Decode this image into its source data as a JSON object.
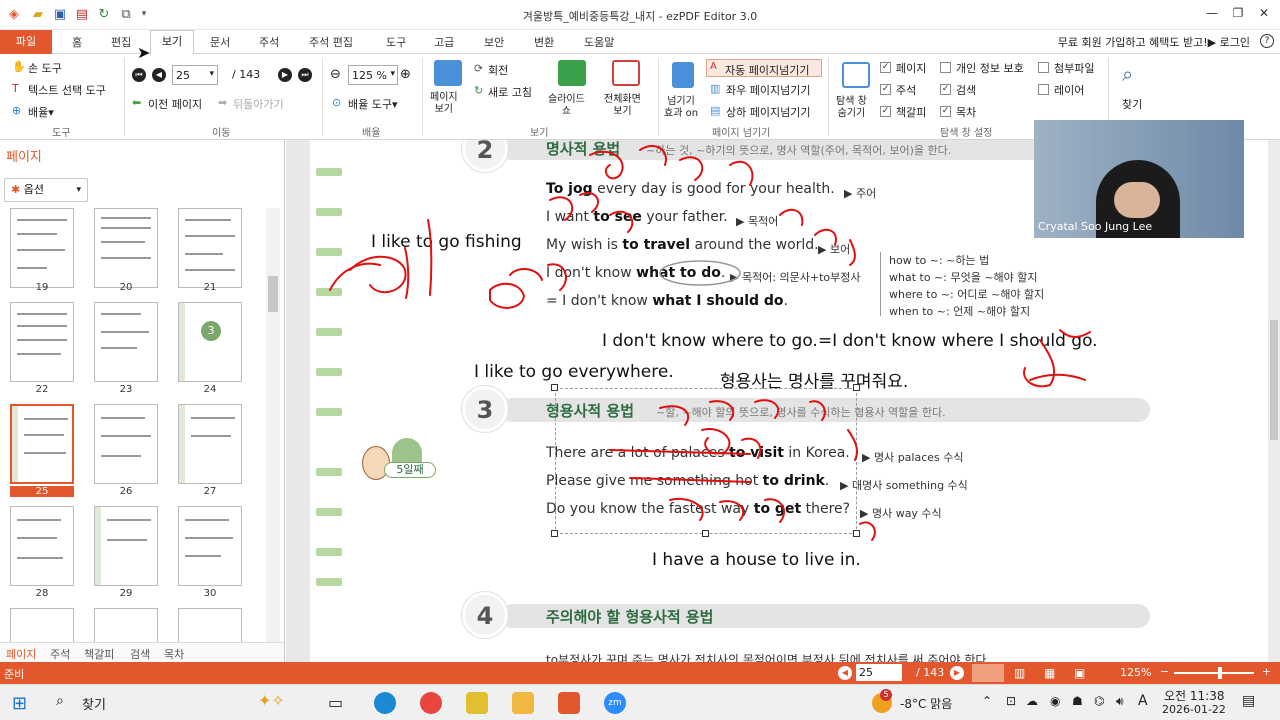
{
  "window": {
    "title": "겨울방특_예비중등특강_내지 - ezPDF Editor 3.0"
  },
  "ribbon_tabs": [
    "파일",
    "홈",
    "편집",
    "보기",
    "문서",
    "주석",
    "주석 편집",
    "도구",
    "고급",
    "보안",
    "변환",
    "도움말"
  ],
  "promo_text": "무료 회원 가입하고 혜택도 받고!▶ 로그인",
  "ribbon": {
    "tools": {
      "hand": "손 도구",
      "text_select": "텍스트 선택 도구",
      "zoom_menu": "배율",
      "group": "도구"
    },
    "move": {
      "page_value": "25",
      "page_total": "/ 143",
      "prev_page": "이전 페이지",
      "go_back": "뒤돌아가기",
      "group": "이동"
    },
    "zoom": {
      "value": "125 %",
      "zoom_tool": "배율 도구",
      "group": "배율"
    },
    "view": {
      "page_view": "페이지\n보기",
      "rotate": "회전",
      "refresh": "새로 고침",
      "slideshow": "슬라이드\n쇼",
      "fullscreen": "전체화면\n보기",
      "group": "보기"
    },
    "page_turn": {
      "effect": "넘기기\n효과 on",
      "auto": "자동 페이지넘기기",
      "left_right": "좌우 페이지넘기기",
      "up_down": "상하 페이지넘기기",
      "group": "페이지 넘기기"
    },
    "nav_pane": {
      "toggle": "탐색 창\n숨기기",
      "group": "탐색 창 설정",
      "checks": [
        {
          "label": "페이지",
          "checked": true
        },
        {
          "label": "개인 정보 보호",
          "checked": false
        },
        {
          "label": "첨부파일",
          "checked": false
        },
        {
          "label": "주석",
          "checked": true
        },
        {
          "label": "검색",
          "checked": true
        },
        {
          "label": "레이어",
          "checked": false
        },
        {
          "label": "책갈피",
          "checked": true
        },
        {
          "label": "목차",
          "checked": true
        }
      ]
    },
    "find": "찾기"
  },
  "sidebar": {
    "title": "페이지",
    "options": "옵션",
    "thumbnails": [
      "19",
      "20",
      "21",
      "22",
      "23",
      "24",
      "25",
      "26",
      "27",
      "28",
      "29",
      "30"
    ],
    "selected": "25",
    "bottom_tabs": [
      "페이지",
      "주석",
      "책갈피",
      "검색",
      "목차"
    ]
  },
  "document": {
    "section2": {
      "num": "2",
      "title": "명사적 용법",
      "subtitle": "~하는 것, ~하기의 뜻으로, 명사 역할(주어, 목적어, 보어)을 한다.",
      "examples": [
        {
          "pre": "",
          "bold": "To jog",
          "post": " every day is good for your health.",
          "note": "▶ 주어"
        },
        {
          "pre": "I want ",
          "bold": "to see",
          "post": " your father.",
          "note": "▶ 목적어"
        },
        {
          "pre": "My wish is ",
          "bold": "to travel",
          "post": " around the world.",
          "note": "▶ 보어"
        },
        {
          "pre": "I don't know ",
          "bold": "what to do",
          "post": ".",
          "note": "▶ 목적어: 의문사+to부정사"
        },
        {
          "pre": "= I don't know ",
          "bold": "what I should do",
          "post": ".",
          "note": ""
        }
      ],
      "side_notes": [
        "how to ~: ~하는 법",
        "what to ~: 무엇을 ~해야 할지",
        "where to ~: 어디로 ~해야 할지",
        "when to ~: 언제 ~해야 할지"
      ]
    },
    "section3": {
      "num": "3",
      "title": "형용사적 용법",
      "subtitle": "~할, ~해야 할의 뜻으로, 명사를 수식하는 형용사 역할을 한다.",
      "day_badge": "5일째",
      "examples": [
        {
          "pre": "There are a lot of palaces ",
          "bold": "to visit",
          "post": " in Korea.",
          "note": "▶ 명사 palaces 수식"
        },
        {
          "pre": "Please give me something hot ",
          "bold": "to drink",
          "post": ".",
          "note": "▶ 대명사 something 수식"
        },
        {
          "pre": "Do you know the fastest way ",
          "bold": "to get",
          "post": " there?",
          "note": "▶ 명사 way 수식"
        }
      ]
    },
    "section4": {
      "num": "4",
      "title": "주의해야 할 형용사적 용법",
      "body": "to부정사가 꾸며 주는 명사가 전치사의 목적어이면 부정사 뒤에 전치사를 써 주어야 한다."
    },
    "typed_annotations": [
      "I like to go fishing",
      "I don't know where to go.=I don't know where I should go.",
      "I like to go everywhere.",
      "형용사는 명사를 꾸며줘요.",
      "I have a house to live in."
    ]
  },
  "video": {
    "name": "Cryatal Soo Jung Lee"
  },
  "status": {
    "left": "준비",
    "page": "25",
    "total": "/ 143",
    "zoom": "125%"
  },
  "taskbar": {
    "search": "찾기",
    "weather": "-8°C 맑음",
    "weather_badge": "5",
    "lang": "A",
    "time": "오전 11:38",
    "date": "2026-01-22"
  },
  "colors": {
    "accent": "#e2572b",
    "ink": "#e01010",
    "section_title": "#2e6b40"
  }
}
